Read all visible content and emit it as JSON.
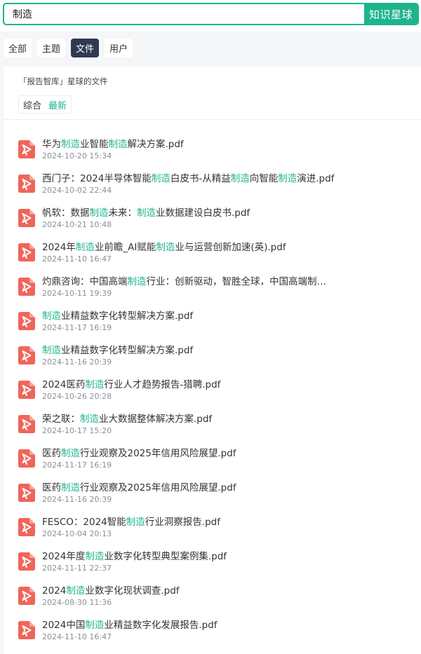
{
  "search": {
    "value": "制造",
    "button_label": "知识星球"
  },
  "type_tabs": [
    {
      "label": "全部",
      "active": false
    },
    {
      "label": "主题",
      "active": false
    },
    {
      "label": "文件",
      "active": true
    },
    {
      "label": "用户",
      "active": false
    }
  ],
  "panel": {
    "title": "「报告智库」星球的文件",
    "sort_tabs": [
      {
        "label": "综合",
        "active": false
      },
      {
        "label": "最新",
        "active": true
      }
    ]
  },
  "highlight_term": "制造",
  "files": [
    {
      "name": "华为制造业智能制造解决方案.pdf",
      "date": "2024-10-20 15:34"
    },
    {
      "name": "西门子：2024半导体智能制造白皮书-从精益制造向智能制造演进.pdf",
      "date": "2024-10-02 22:44"
    },
    {
      "name": "帆软：数据制造未来：制造业数据建设白皮书.pdf",
      "date": "2024-10-21 10:48"
    },
    {
      "name": "2024年制造业前瞻_AI赋能制造业与运营创新加速(英).pdf",
      "date": "2024-11-10 16:47"
    },
    {
      "name": "灼鼎咨询：中国高端制造行业：创新驱动，智胜全球，中国高端制…",
      "date": "2024-10-11 19:39"
    },
    {
      "name": "制造业精益数字化转型解决方案.pdf",
      "date": "2024-11-17 16:19"
    },
    {
      "name": "制造业精益数字化转型解决方案.pdf",
      "date": "2024-11-16 20:39"
    },
    {
      "name": "2024医药制造行业人才趋势报告-猎聘.pdf",
      "date": "2024-10-26 20:28"
    },
    {
      "name": "荣之联：制造业大数据整体解决方案.pdf",
      "date": "2024-10-17 15:20"
    },
    {
      "name": "医药制造行业观察及2025年信用风险展望.pdf",
      "date": "2024-11-17 16:19"
    },
    {
      "name": "医药制造行业观察及2025年信用风险展望.pdf",
      "date": "2024-11-16 20:39"
    },
    {
      "name": "FESCO：2024智能制造行业洞察报告.pdf",
      "date": "2024-10-04 20:13"
    },
    {
      "name": "2024年度制造业数字化转型典型案例集.pdf",
      "date": "2024-11-11 22:37"
    },
    {
      "name": "2024制造业数字化现状调查.pdf",
      "date": "2024-08-30 11:36"
    },
    {
      "name": "2024中国制造业精益数字化发展报告.pdf",
      "date": "2024-11-10 16:47"
    }
  ],
  "colors": {
    "accent": "#1eb48e",
    "pdf_icon": "#f0655a",
    "active_tab": "#2f3a52"
  },
  "icons": {
    "file": "pdf-file-icon"
  }
}
